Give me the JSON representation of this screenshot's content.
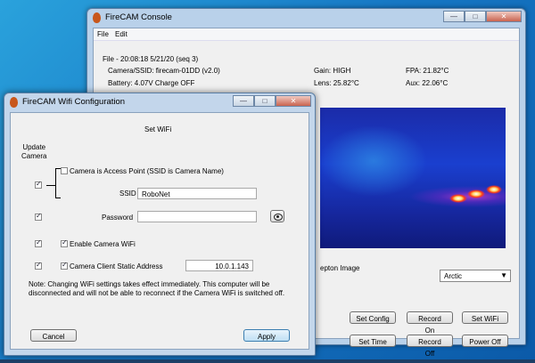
{
  "console": {
    "title": "FireCAM Console",
    "menu": [
      "File",
      "Edit"
    ],
    "file_line": "File - 20:08:18 5/21/20  (seq 3)",
    "camera_ssid": "Camera/SSID: firecam-01DD  (v2.0)",
    "gain": "Gain: HIGH",
    "fpa": "FPA: 21.82°C",
    "battery": "Battery: 4.07V   Charge OFF",
    "lens": "Lens: 25.82°C",
    "aux": "Aux: 22.06°C",
    "image_caption": "epton Image",
    "palette_value": "Arctic",
    "buttons": {
      "set_config": "Set Config",
      "record_on": "Record On",
      "set_wifi": "Set WiFi",
      "set_time": "Set Time",
      "record_off": "Record Off",
      "power_off": "Power Off"
    }
  },
  "wifi": {
    "title": "FireCAM Wifi Configuration",
    "header": "Set WiFi",
    "update_camera_label": "Update\nCamera",
    "access_point_label": "Camera is Access Point (SSID is Camera Name)",
    "ssid_label": "SSID",
    "ssid_value": "RoboNet",
    "password_label": "Password",
    "password_value": "",
    "enable_wifi_label": "Enable Camera WiFi",
    "static_address_label": "Camera Client Static Address",
    "static_address_value": "10.0.1.143",
    "note": "Note: Changing WiFi settings takes effect immediately.  This computer will be disconnected and will not be able to reconnect if the Camera WiFi is switched off.",
    "cancel_label": "Cancel",
    "apply_label": "Apply"
  }
}
